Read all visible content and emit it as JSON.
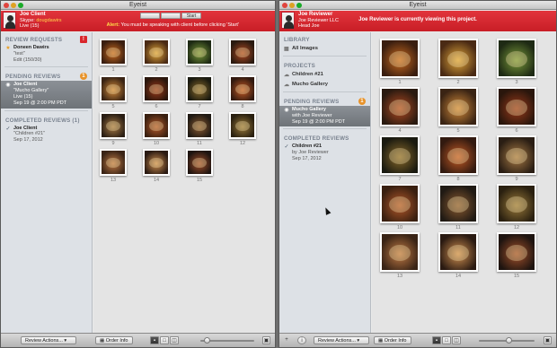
{
  "left": {
    "window_title": "Eyeist",
    "user_name": "Joe Client",
    "user_line2_prefix": "Skype: ",
    "user_line2_account": "dougdawirs",
    "user_line3": "Live (15)",
    "controls": [
      "",
      "",
      "Start"
    ],
    "alert_label": "Alert:",
    "alert_text": " You must be speaking with client before clicking 'Start'",
    "sections": {
      "requests": {
        "title": "REVIEW REQUESTS",
        "badge": "!",
        "entry": {
          "name": "Doneen Dawirs",
          "project": "\"test\"",
          "status": "Edit (150/30)"
        }
      },
      "pending": {
        "title": "PENDING REVIEWS",
        "badge": "1",
        "entry": {
          "name": "Joe Client",
          "project": "\"Mucho Gallery\"",
          "status": "Live (15)",
          "date": "Sep 19 @ 2:00 PM PDT"
        }
      },
      "completed": {
        "title": "COMPLETED REVIEWS (1)",
        "entry": {
          "name": "Joe Client",
          "project": "\"Children #21\"",
          "date": "Sep 17, 2012"
        }
      }
    },
    "thumbnails": [
      "1",
      "2",
      "3",
      "4",
      "5",
      "6",
      "7",
      "8",
      "9",
      "10",
      "11",
      "12",
      "13",
      "14",
      "15"
    ],
    "bottom": {
      "actions": "Review Actions...",
      "order": "Order Info"
    }
  },
  "right": {
    "window_title": "Eyeist",
    "user_name": "Joe Reviewer",
    "user_line2": "Joe Reviewer LLC",
    "user_line3": "Head Joe",
    "center_message": "Joe Reviewer is currently viewing this project.",
    "sections": {
      "library": {
        "title": "LIBRARY",
        "item": "All Images"
      },
      "projects": {
        "title": "PROJECTS",
        "items": [
          "Children #21",
          "Mucho Gallery"
        ]
      },
      "pending": {
        "title": "PENDING REVIEWS",
        "badge": "1",
        "entry": {
          "name": "Mucho Gallery",
          "with": "with Joe Reviewer",
          "date": "Sep 19 @ 2:00 PM PDT"
        }
      },
      "completed": {
        "title": "COMPLETED REVIEWS",
        "entry": {
          "name": "Children #21",
          "by": "by Joe Reviewer",
          "date": "Sep 17, 2012"
        }
      }
    },
    "thumbnails": [
      "1",
      "2",
      "3",
      "4",
      "5",
      "6",
      "7",
      "8",
      "9",
      "10",
      "11",
      "12",
      "13",
      "14",
      "15"
    ],
    "bottom": {
      "add": "+",
      "info": "i",
      "actions": "Review Actions...",
      "order": "Order Info"
    }
  },
  "colors": {
    "banner": "#d0252d",
    "selected": "#7b8086",
    "star": "#e99d20"
  }
}
